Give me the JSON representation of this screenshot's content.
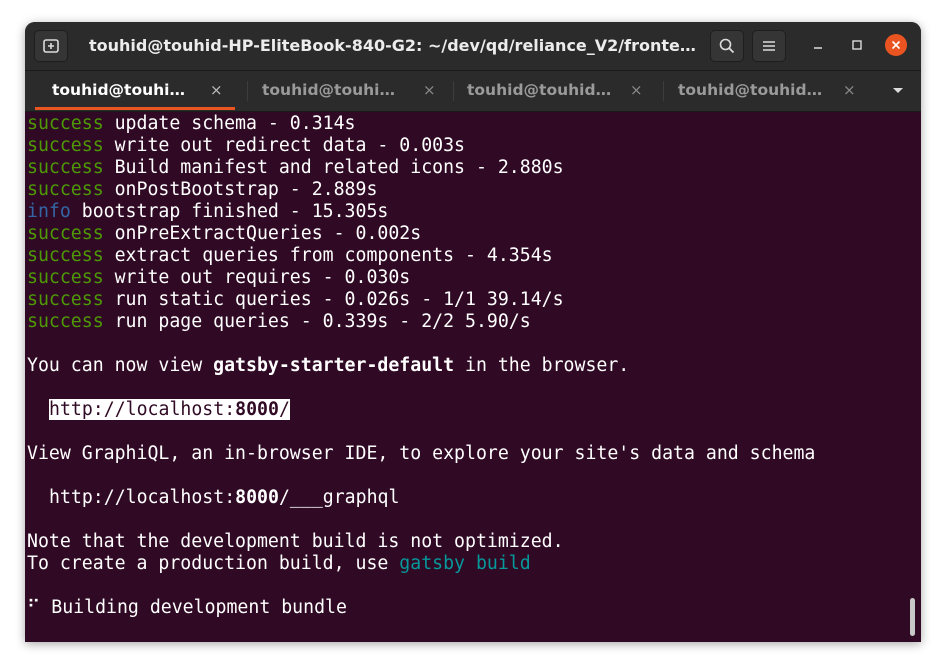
{
  "window": {
    "title": "touhid@touhid-HP-EliteBook-840-G2: ~/dev/qd/reliance_V2/fronte…",
    "colors": {
      "terminal_bg": "#300a24",
      "titlebar_bg": "#2b2b2b",
      "accent": "#e95420",
      "success": "#4e9a06",
      "info": "#3465a4",
      "command": "#06989a"
    }
  },
  "tabs": [
    {
      "label": "touhid@touhi…",
      "active": true
    },
    {
      "label": "touhid@touhi…",
      "active": false
    },
    {
      "label": "touhid@touhid…",
      "active": false
    },
    {
      "label": "touhid@touhid…",
      "active": false
    }
  ],
  "tab_close_glyph": "×",
  "output": {
    "log": [
      {
        "level": "success",
        "text": " update schema - 0.314s"
      },
      {
        "level": "success",
        "text": " write out redirect data - 0.003s"
      },
      {
        "level": "success",
        "text": " Build manifest and related icons - 2.880s"
      },
      {
        "level": "success",
        "text": " onPostBootstrap - 2.889s"
      },
      {
        "level": "info",
        "text": " bootstrap finished - 15.305s"
      },
      {
        "level": "success",
        "text": " onPreExtractQueries - 0.002s"
      },
      {
        "level": "success",
        "text": " extract queries from components - 4.354s"
      },
      {
        "level": "success",
        "text": " write out requires - 0.030s"
      },
      {
        "level": "success",
        "text": " run static queries - 0.026s - 1/1 39.14/s"
      },
      {
        "level": "success",
        "text": " run page queries - 0.339s - 2/2 5.90/s"
      }
    ],
    "view_prefix": "You can now view ",
    "site_name": "gatsby-starter-default",
    "view_suffix": " in the browser.",
    "local_url_prefix": "http://localhost:",
    "local_url_port": "8000",
    "local_url_suffix": "/",
    "graphiql_text": "View GraphiQL, an in-browser IDE, to explore your site's data and schema",
    "graphql_url_prefix": "http://localhost:",
    "graphql_url_port": "8000",
    "graphql_url_suffix": "/___graphql",
    "note_line": "Note that the development build is not optimized.",
    "prod_prefix": "To create a production build, use ",
    "prod_command": "gatsby build",
    "spinner": "⠋",
    "building": " Building development bundle"
  }
}
